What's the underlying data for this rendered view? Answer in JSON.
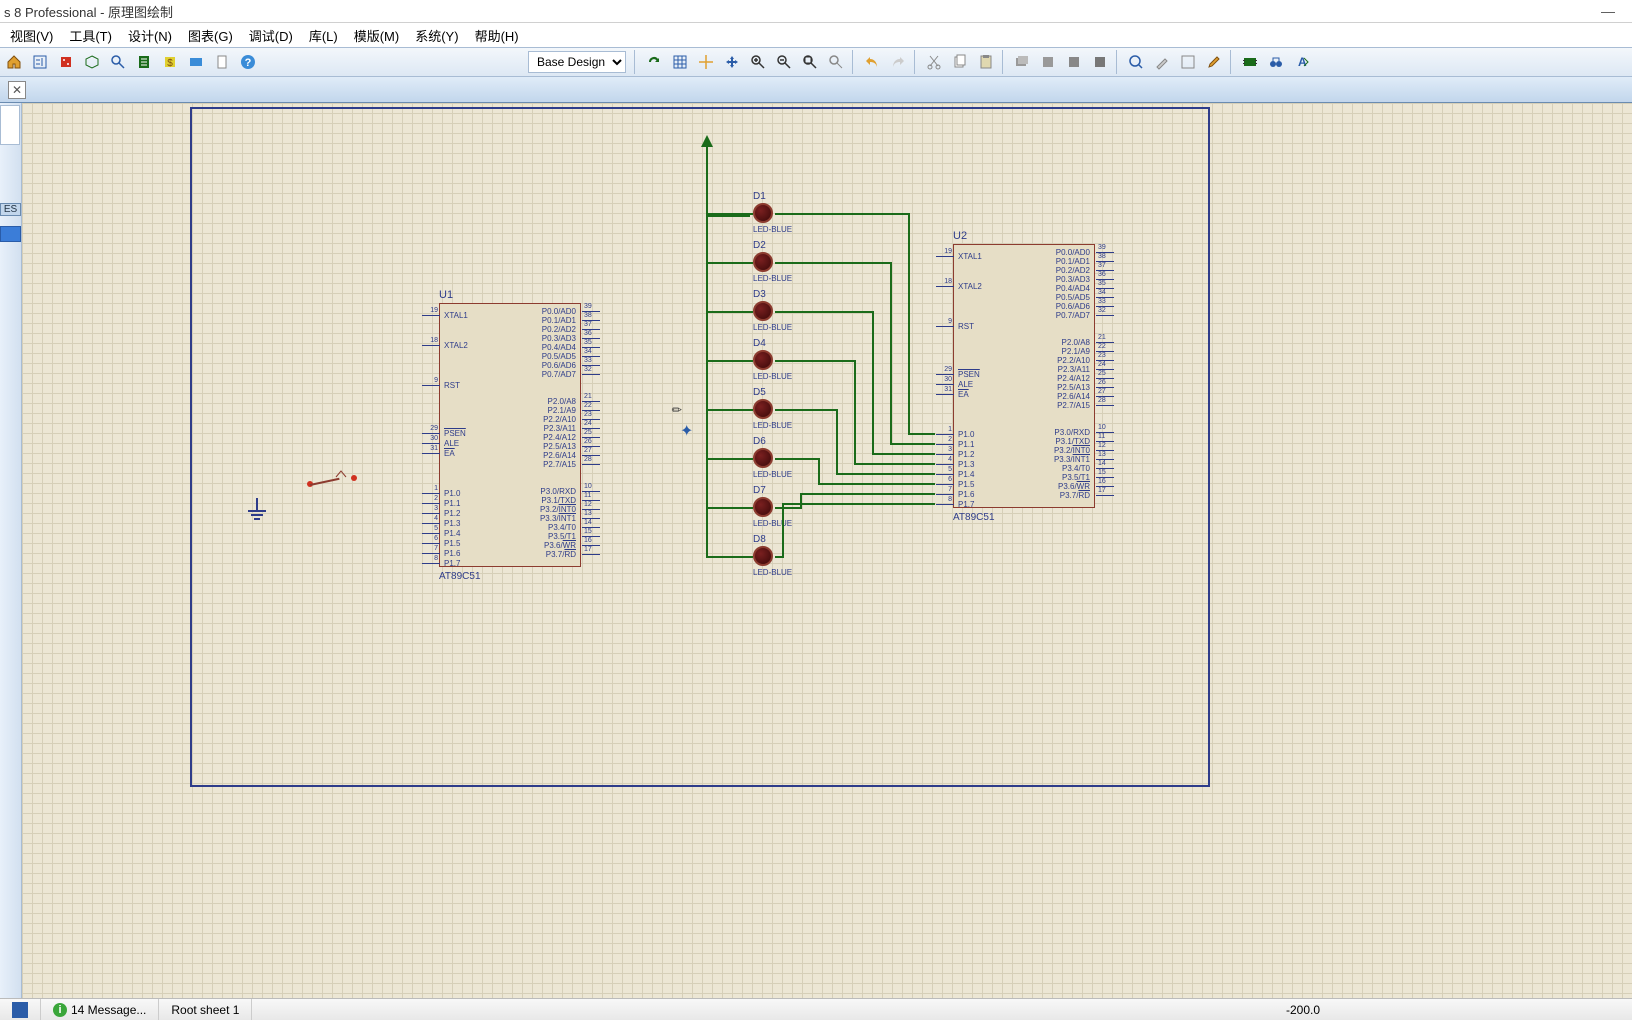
{
  "title": "s 8 Professional - 原理图绘制",
  "menus": {
    "view": "视图(V)",
    "tool": "工具(T)",
    "design": "设计(N)",
    "chart": "图表(G)",
    "debug": "调试(D)",
    "library": "库(L)",
    "template": "模版(M)",
    "system": "系统(Y)",
    "help": "帮助(H)"
  },
  "design_selector": "Base Design",
  "sidebar_label": "ES",
  "statusbar": {
    "messages": "14 Message...",
    "sheet": "Root sheet 1",
    "coord": "-200.0"
  },
  "chips": {
    "u1": {
      "ref": "U1",
      "value": "AT89C51",
      "left_pins": [
        {
          "num": "19",
          "name": "XTAL1"
        },
        {
          "num": "18",
          "name": "XTAL2"
        },
        {
          "num": "9",
          "name": "RST"
        },
        {
          "num": "29",
          "name": "PSEN",
          "over": true
        },
        {
          "num": "30",
          "name": "ALE"
        },
        {
          "num": "31",
          "name": "EA",
          "over": true
        },
        {
          "num": "1",
          "name": "P1.0"
        },
        {
          "num": "2",
          "name": "P1.1"
        },
        {
          "num": "3",
          "name": "P1.2"
        },
        {
          "num": "4",
          "name": "P1.3"
        },
        {
          "num": "5",
          "name": "P1.4"
        },
        {
          "num": "6",
          "name": "P1.5"
        },
        {
          "num": "7",
          "name": "P1.6"
        },
        {
          "num": "8",
          "name": "P1.7"
        }
      ],
      "right_pins": [
        {
          "num": "39",
          "name": "P0.0/AD0"
        },
        {
          "num": "38",
          "name": "P0.1/AD1"
        },
        {
          "num": "37",
          "name": "P0.2/AD2"
        },
        {
          "num": "36",
          "name": "P0.3/AD3"
        },
        {
          "num": "35",
          "name": "P0.4/AD4"
        },
        {
          "num": "34",
          "name": "P0.5/AD5"
        },
        {
          "num": "33",
          "name": "P0.6/AD6"
        },
        {
          "num": "32",
          "name": "P0.7/AD7"
        },
        {
          "num": "21",
          "name": "P2.0/A8"
        },
        {
          "num": "22",
          "name": "P2.1/A9"
        },
        {
          "num": "23",
          "name": "P2.2/A10"
        },
        {
          "num": "24",
          "name": "P2.3/A11"
        },
        {
          "num": "25",
          "name": "P2.4/A12"
        },
        {
          "num": "26",
          "name": "P2.5/A13"
        },
        {
          "num": "27",
          "name": "P2.6/A14"
        },
        {
          "num": "28",
          "name": "P2.7/A15"
        },
        {
          "num": "10",
          "name": "P3.0/RXD"
        },
        {
          "num": "11",
          "name": "P3.1/TXD"
        },
        {
          "num": "12",
          "name": "P3.2/INT0",
          "over_part": "INT0"
        },
        {
          "num": "13",
          "name": "P3.3/INT1",
          "over_part": "INT1"
        },
        {
          "num": "14",
          "name": "P3.4/T0"
        },
        {
          "num": "15",
          "name": "P3.5/T1"
        },
        {
          "num": "16",
          "name": "P3.6/WR",
          "over_part": "WR"
        },
        {
          "num": "17",
          "name": "P3.7/RD",
          "over_part": "RD"
        }
      ]
    },
    "u2": {
      "ref": "U2",
      "value": "AT89C51"
    }
  },
  "leds": [
    {
      "ref": "D1",
      "value": "LED-BLUE"
    },
    {
      "ref": "D2",
      "value": "LED-BLUE"
    },
    {
      "ref": "D3",
      "value": "LED-BLUE"
    },
    {
      "ref": "D4",
      "value": "LED-BLUE"
    },
    {
      "ref": "D5",
      "value": "LED-BLUE"
    },
    {
      "ref": "D6",
      "value": "LED-BLUE"
    },
    {
      "ref": "D7",
      "value": "LED-BLUE"
    },
    {
      "ref": "D8",
      "value": "LED-BLUE"
    }
  ]
}
